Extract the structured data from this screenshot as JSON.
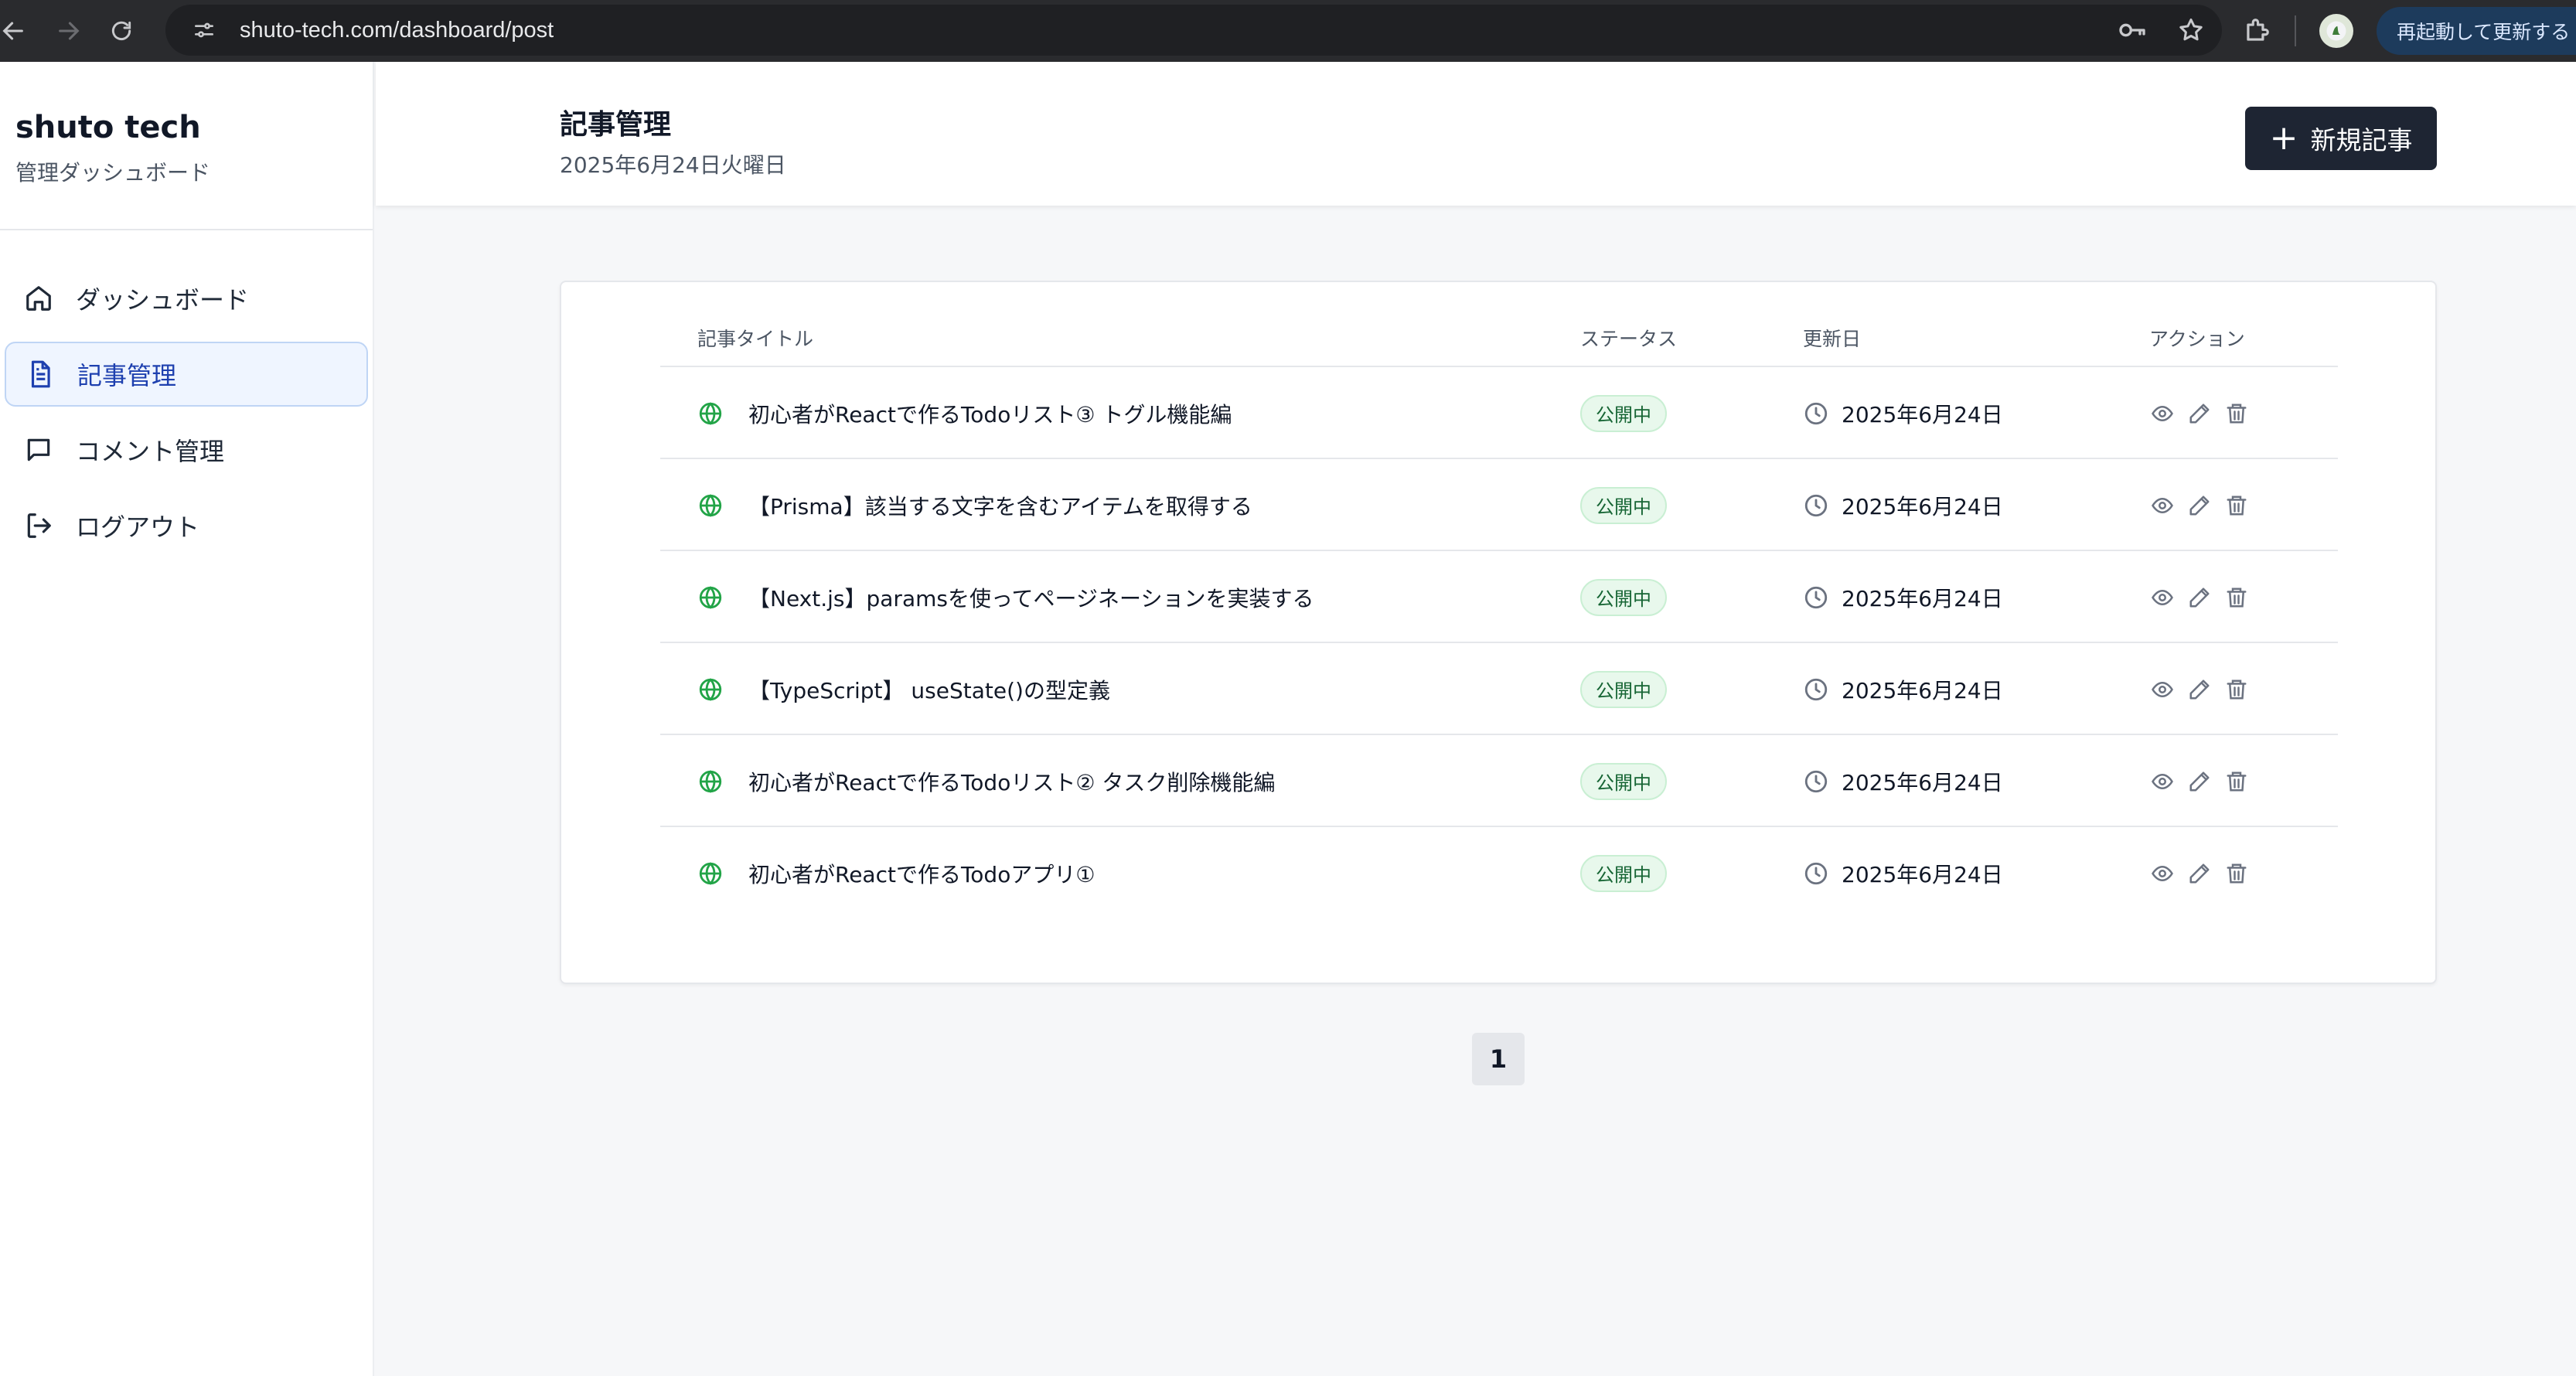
{
  "browser": {
    "url": "shuto-tech.com/dashboard/post",
    "update_button": "再起動して更新する"
  },
  "sidebar": {
    "brand_title": "shuto tech",
    "brand_subtitle": "管理ダッシュボード",
    "items": [
      {
        "label": "ダッシュボード",
        "icon": "home-icon",
        "active": false
      },
      {
        "label": "記事管理",
        "icon": "document-icon",
        "active": true
      },
      {
        "label": "コメント管理",
        "icon": "comment-icon",
        "active": false
      },
      {
        "label": "ログアウト",
        "icon": "logout-icon",
        "active": false
      }
    ]
  },
  "header": {
    "title": "記事管理",
    "date": "2025年6月24日火曜日",
    "new_post_label": "新規記事"
  },
  "table": {
    "columns": [
      "記事タイトル",
      "ステータス",
      "更新日",
      "アクション"
    ],
    "rows": [
      {
        "title": "初心者がReactで作るTodoリスト③ トグル機能編",
        "status": "公開中",
        "updated": "2025年6月24日"
      },
      {
        "title": "【Prisma】該当する文字を含むアイテムを取得する",
        "status": "公開中",
        "updated": "2025年6月24日"
      },
      {
        "title": "【Next.js】paramsを使ってページネーションを実装する",
        "status": "公開中",
        "updated": "2025年6月24日"
      },
      {
        "title": "【TypeScript】 useState()の型定義",
        "status": "公開中",
        "updated": "2025年6月24日"
      },
      {
        "title": "初心者がReactで作るTodoリスト② タスク削除機能編",
        "status": "公開中",
        "updated": "2025年6月24日"
      },
      {
        "title": "初心者がReactで作るTodoアプリ①",
        "status": "公開中",
        "updated": "2025年6月24日"
      }
    ]
  },
  "pagination": {
    "current_page": "1"
  },
  "colors": {
    "accent_active_bg": "#eff5ff",
    "status_green": "#22a447",
    "primary_button": "#1e2533"
  }
}
